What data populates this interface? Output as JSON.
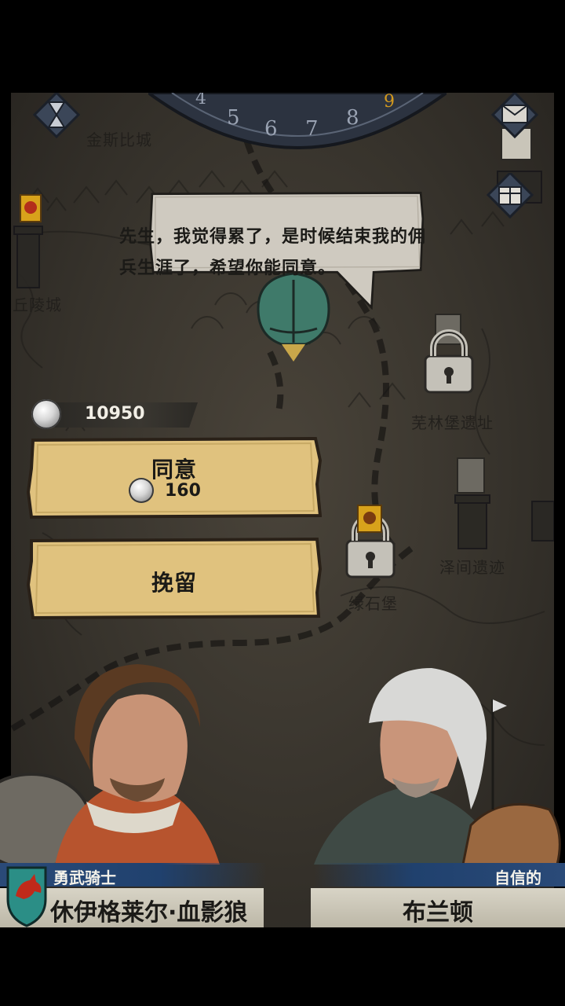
{
  "map": {
    "locations": [
      {
        "label": "金斯比城"
      },
      {
        "label": "丘陵城"
      },
      {
        "label": "芜林堡遗址"
      },
      {
        "label": "泽间遗迹"
      },
      {
        "label": "绿石堡"
      }
    ],
    "dial_numbers": [
      "4",
      "5",
      "6",
      "7",
      "8",
      "9"
    ]
  },
  "dialogue": {
    "line1": "先生，我觉得累了，是时候结束我的佣",
    "line2": "兵生涯了，希望你能同意。"
  },
  "currency": {
    "icon": "silver-coin-icon",
    "amount": "10950"
  },
  "actions": {
    "agree": {
      "label": "同意",
      "cost": "160"
    },
    "retain": {
      "label": "挽留"
    }
  },
  "characters": {
    "left": {
      "title": "勇武骑士",
      "name": "休伊格莱尔·血影狼",
      "crest_icon": "wolf-crest-icon"
    },
    "right": {
      "trait": "自信的",
      "name": "布兰顿"
    }
  },
  "colors": {
    "title_bar": "#2a4a78",
    "parchment": "#e0c27e",
    "map": "#3a362f"
  }
}
